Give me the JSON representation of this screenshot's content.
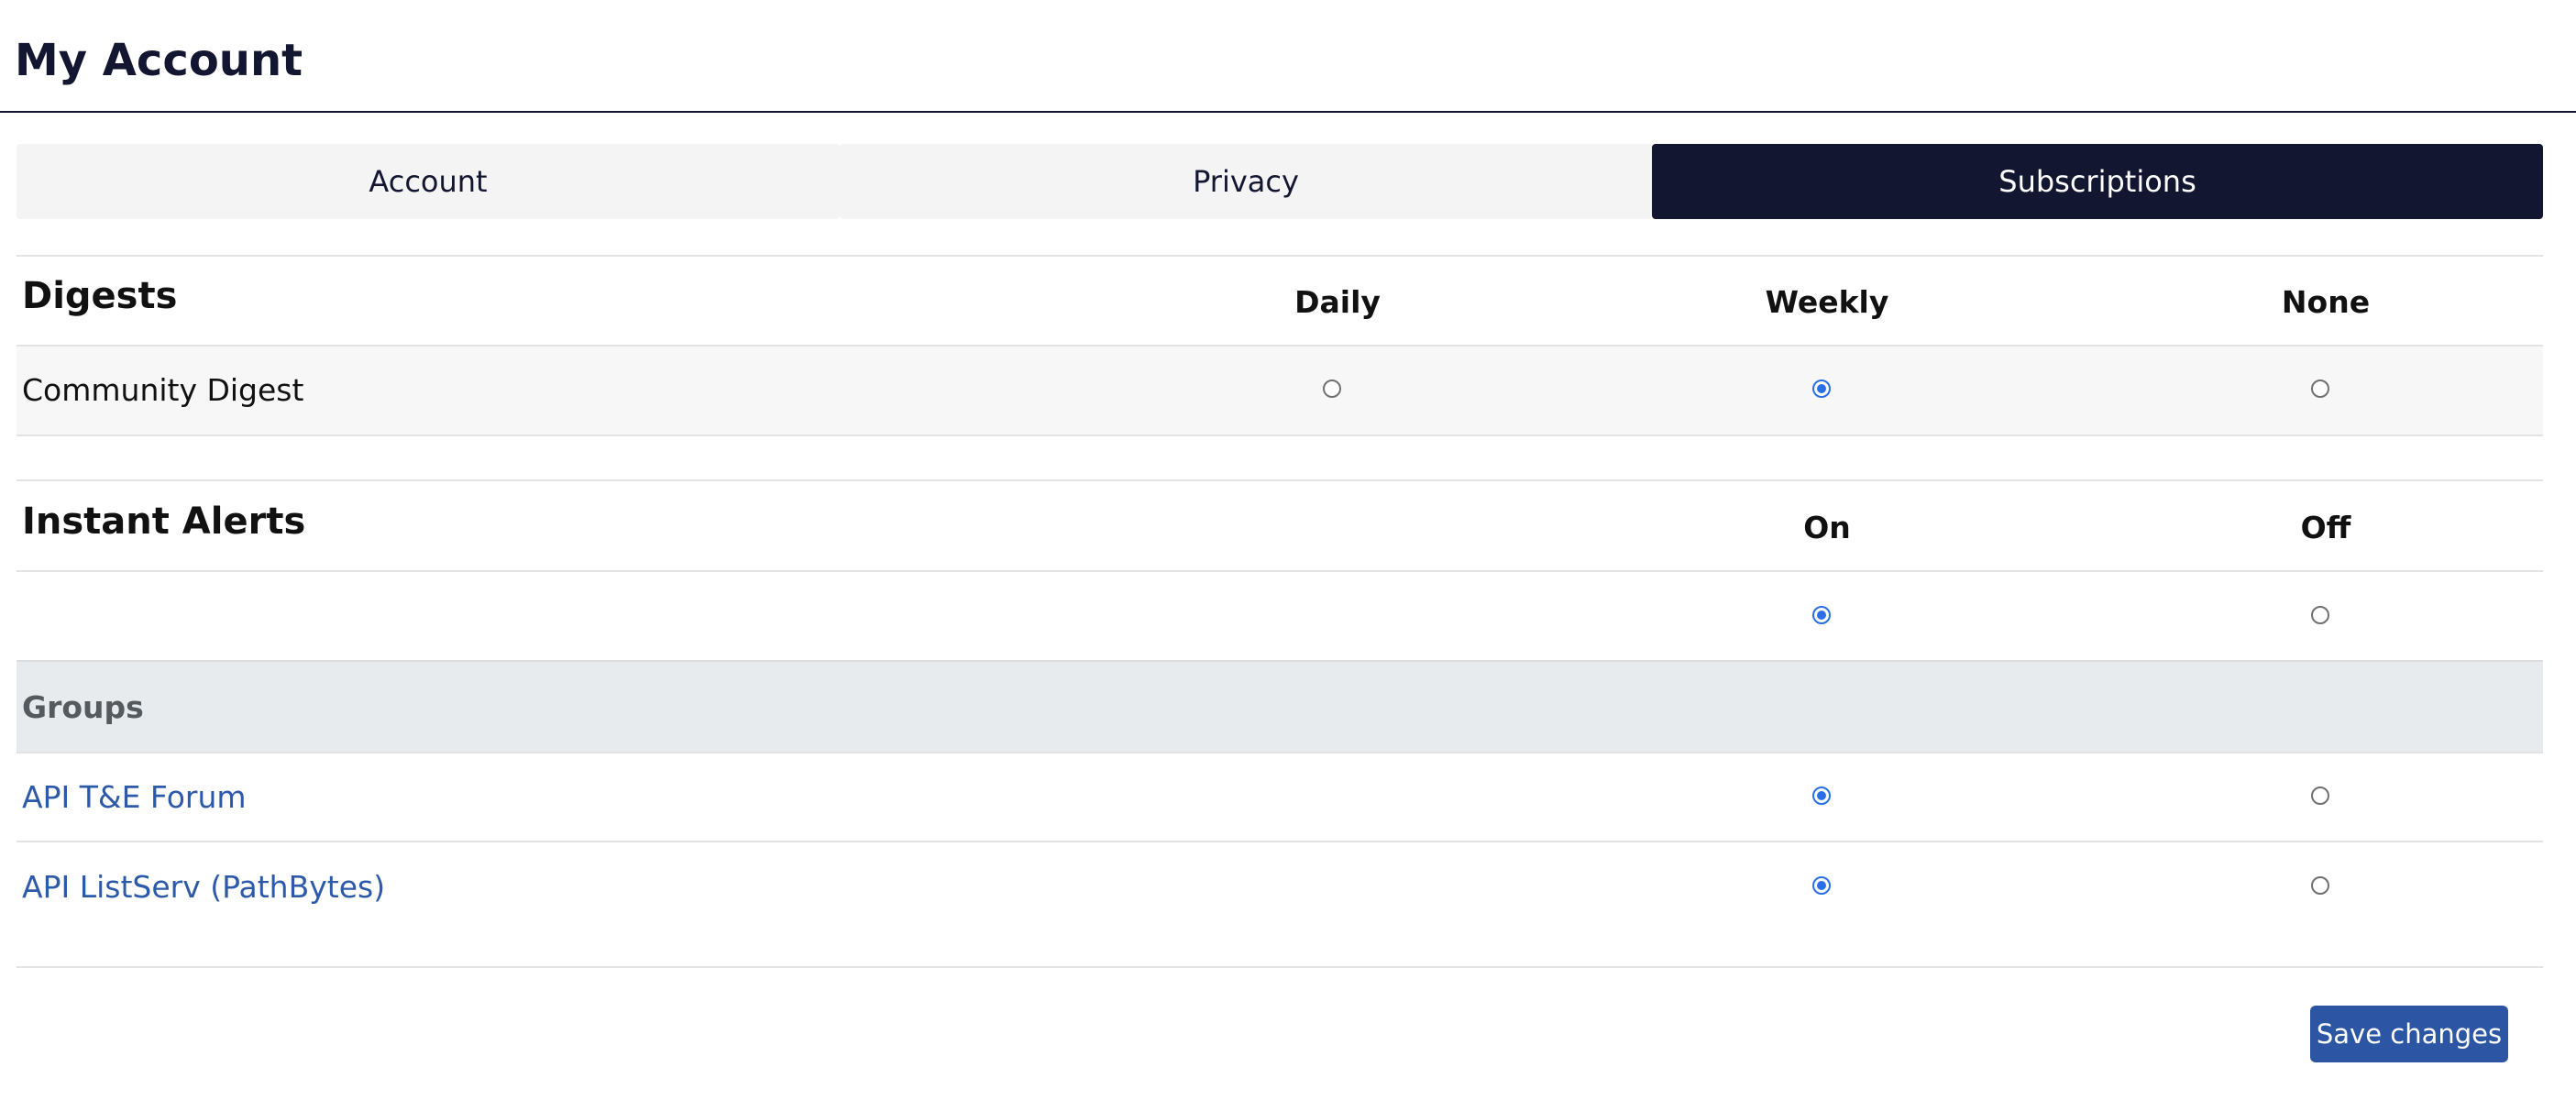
{
  "page": {
    "title": "My Account"
  },
  "tabs": [
    {
      "label": "Account"
    },
    {
      "label": "Privacy"
    },
    {
      "label": "Subscriptions"
    }
  ],
  "digests": {
    "title": "Digests",
    "columns": [
      "Daily",
      "Weekly",
      "None"
    ],
    "rows": [
      {
        "label": "Community Digest",
        "selected": "Weekly"
      }
    ]
  },
  "instant_alerts": {
    "title": "Instant Alerts",
    "columns": [
      "On",
      "Off"
    ],
    "global_selected": "On",
    "groups_label": "Groups",
    "groups": [
      {
        "label": "API T&E Forum",
        "selected": "On"
      },
      {
        "label": "API ListServ (PathBytes)",
        "selected": "On"
      }
    ]
  },
  "save_label": "Save changes",
  "colors": {
    "navy": "#131630",
    "accent": "#2a6fe8",
    "link": "#2d5aa8",
    "button": "#2c56a3"
  }
}
